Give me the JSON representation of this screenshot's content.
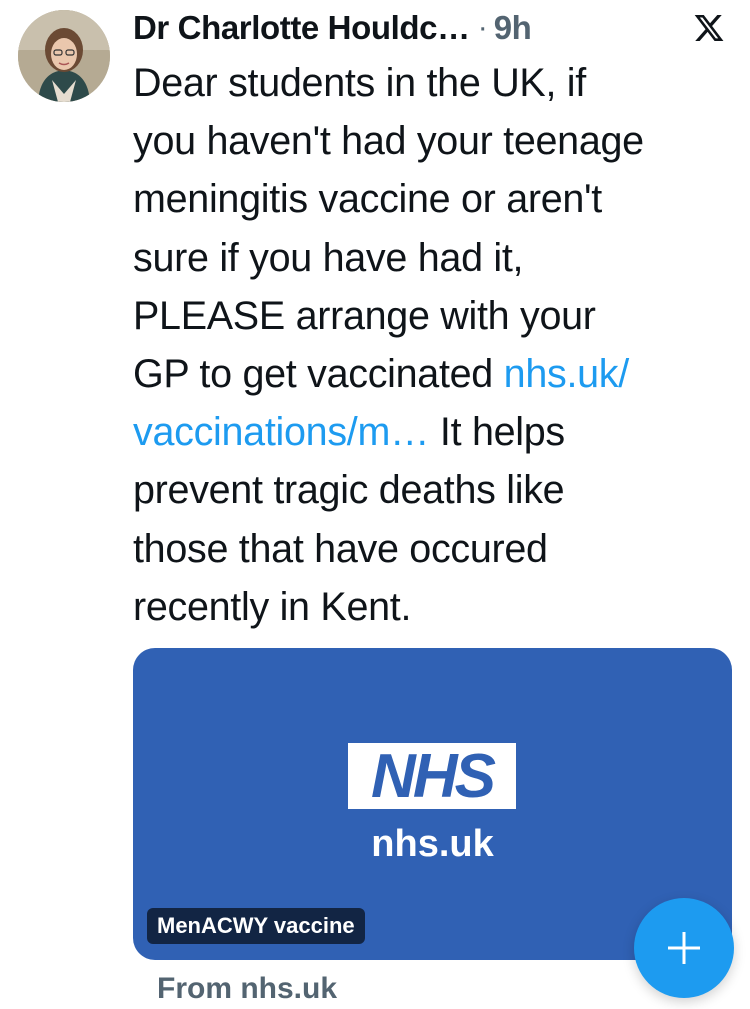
{
  "tweet": {
    "author_name": "Dr Charlotte Houldc…",
    "separator": "·",
    "time": "9h",
    "text_lines": [
      [
        "Dear students in the UK, if",
        ""
      ],
      [
        "you haven't had your teenage",
        ""
      ],
      [
        "meningitis vaccine or aren't",
        ""
      ],
      [
        "sure if you have had it,",
        ""
      ],
      [
        "PLEASE arrange with your",
        ""
      ],
      [
        "GP to get vaccinated ",
        "nhs.uk/"
      ],
      [
        "",
        "vaccinations/m…"
      ],
      [
        " It helps",
        ""
      ],
      [
        "prevent tragic deaths like",
        ""
      ],
      [
        "those that have occured",
        ""
      ],
      [
        "recently in Kent.",
        ""
      ]
    ],
    "line1": "Dear students in the UK, if",
    "line2": "you haven't had your teenage",
    "line3": "meningitis vaccine or aren't",
    "line4": "sure if you have had it,",
    "line5": "PLEASE arrange with your",
    "line6_text": "GP to get vaccinated ",
    "line6_link": "nhs.uk/",
    "line7_link": "vaccinations/m…",
    "line7_text": " It helps",
    "line8": "prevent tragic deaths like",
    "line9": "those that have occured",
    "line10": "recently in Kent."
  },
  "card": {
    "logo_text": "NHS",
    "domain": "nhs.uk",
    "badge": "MenACWY vaccine",
    "from": "From nhs.uk",
    "background_color": "#3061b4"
  },
  "icons": {
    "close": "x-logo-icon",
    "compose": "plus-icon"
  },
  "colors": {
    "link": "#1d9bf0",
    "muted": "#536471",
    "text": "#0f1419"
  }
}
